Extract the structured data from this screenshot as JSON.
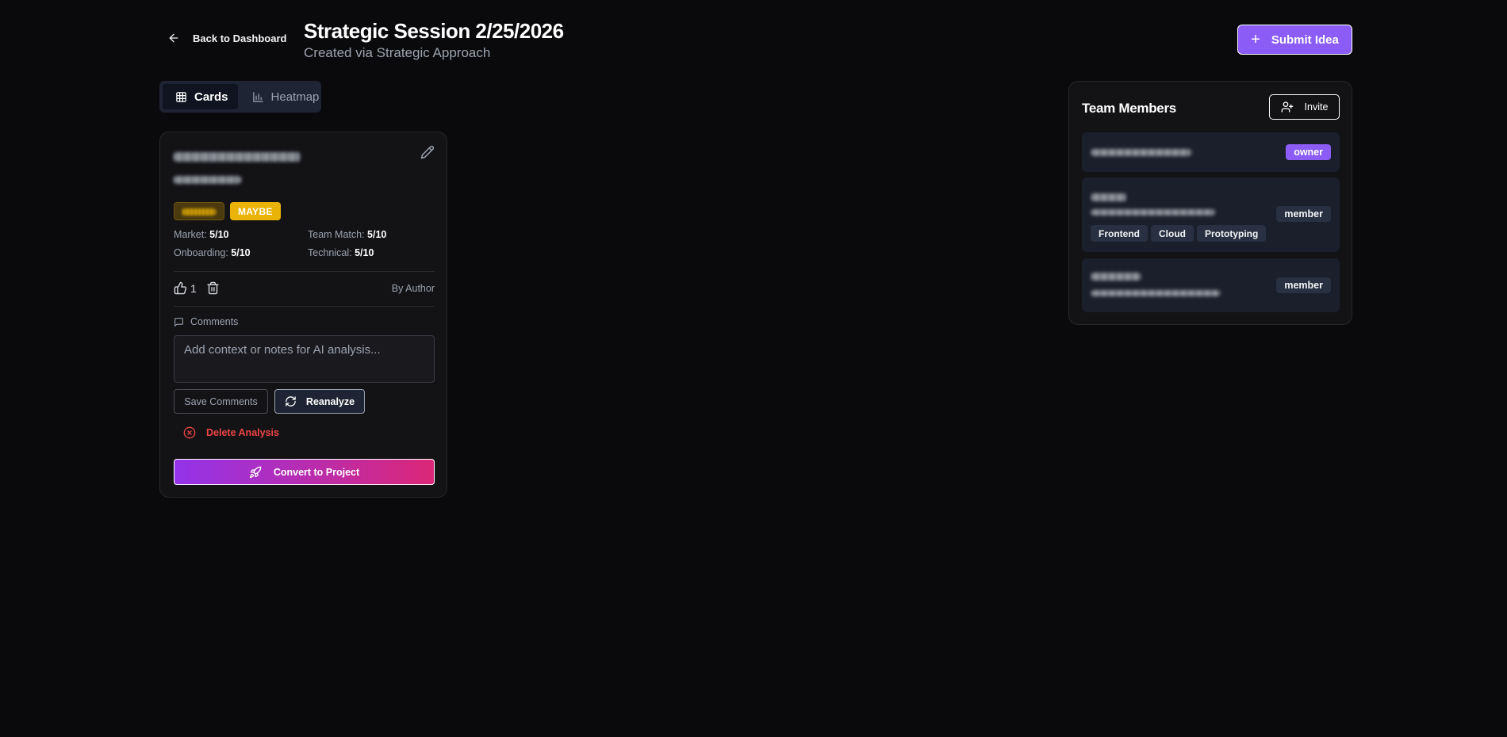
{
  "header": {
    "back_label": "Back to Dashboard",
    "title": "Strategic Session 2/25/2026",
    "subtitle": "Created via Strategic Approach",
    "submit_label": "Submit Idea"
  },
  "view_tabs": [
    {
      "label": "Cards",
      "icon": "grid-icon",
      "active": true
    },
    {
      "label": "Heatmap",
      "icon": "bar-chart-icon",
      "active": false
    }
  ],
  "idea_card": {
    "status_badge": "MAYBE",
    "scores": [
      {
        "label": "Market:",
        "value": "5/10"
      },
      {
        "label": "Team Match:",
        "value": "5/10"
      },
      {
        "label": "Onboarding:",
        "value": "5/10"
      },
      {
        "label": "Technical:",
        "value": "5/10"
      }
    ],
    "vote_count": "1",
    "author": "By Author",
    "comments_label": "Comments",
    "comments_placeholder": "Add context or notes for AI analysis...",
    "comments_value": "",
    "save_label": "Save Comments",
    "reanalyze_label": "Reanalyze",
    "delete_label": "Delete Analysis",
    "convert_label": "Convert to Project"
  },
  "team": {
    "title": "Team Members",
    "invite_label": "Invite",
    "members": [
      {
        "role": "owner",
        "skills": []
      },
      {
        "role": "member",
        "skills": [
          "Frontend",
          "Cloud",
          "Prototyping"
        ]
      },
      {
        "role": "member",
        "skills": []
      }
    ]
  },
  "colors": {
    "background": "#0a0a0c",
    "accent": "#8b5cf6",
    "maybe": "#eab308",
    "danger": "#ef4444",
    "gradient_start": "#9333ea",
    "gradient_end": "#db2777"
  }
}
